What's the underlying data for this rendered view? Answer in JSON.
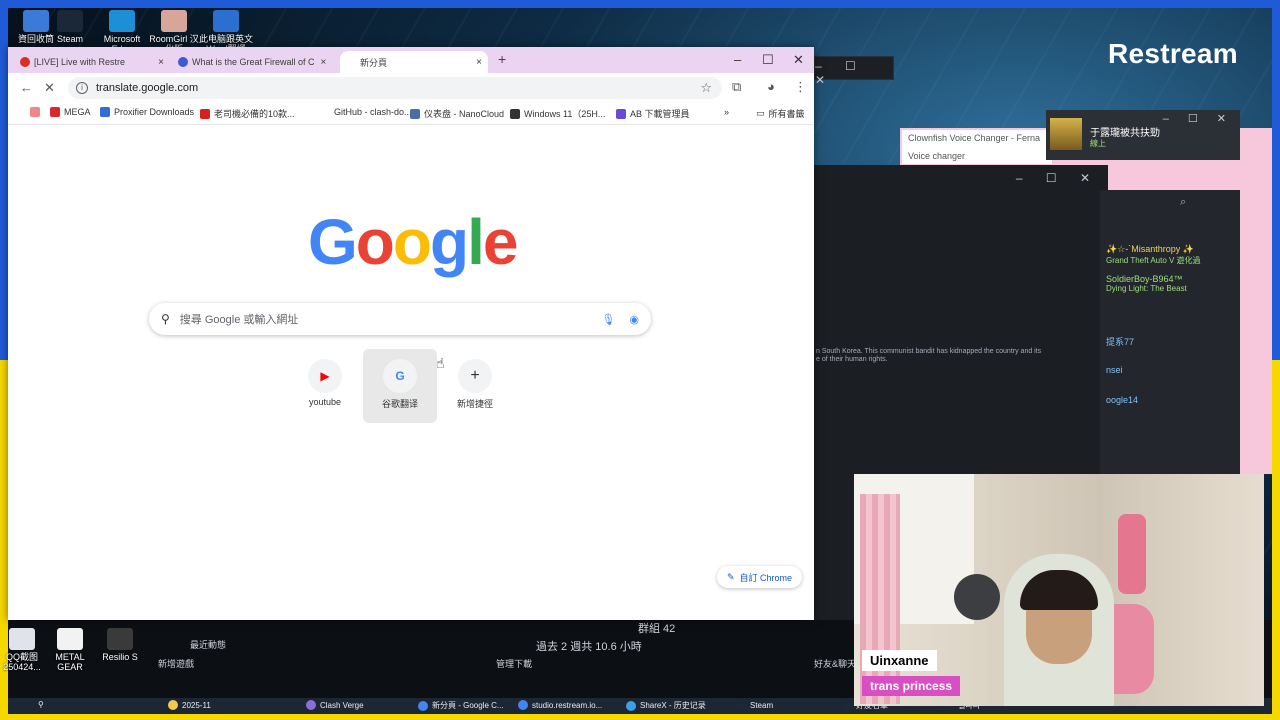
{
  "stream": {
    "logo": "Restream"
  },
  "desktop_icons": [
    {
      "label": "資回收筒",
      "color": "#3c7ad8"
    },
    {
      "label": "Steam",
      "color": "#1b2838"
    },
    {
      "label": "Microsoft Edge",
      "color": "#1c8fd6"
    },
    {
      "label": "RoomGirl 汉化版",
      "color": "#d8a59a"
    },
    {
      "label": "此电脑跟英文Word翻譯",
      "color": "#2b6fd1"
    }
  ],
  "desktop_icons_bottom": [
    {
      "label": "QQ截图 250424...",
      "color": "#e0e4ea"
    },
    {
      "label": "METAL GEAR SOLI...",
      "color": "#f2f2f2"
    },
    {
      "label": "Resilio S",
      "color": "#3a3a3a"
    }
  ],
  "chrome": {
    "tabs": [
      {
        "label": "[LIVE] Live with Restre",
        "fav": "#d93025",
        "close": "×"
      },
      {
        "label": "What is the Great Firewall of C",
        "fav": "#3b5bd6",
        "close": "×"
      },
      {
        "label": "新分頁",
        "fav": "#ffffff",
        "close": "×"
      }
    ],
    "new_tab": "+",
    "window_controls": {
      "min": "–",
      "max": "☐",
      "close": "✕"
    },
    "nav": {
      "back": "←",
      "reload": "✕"
    },
    "url": "translate.google.com",
    "star": "☆",
    "bookmarks": [
      {
        "label": "MEGA",
        "color": "#d9272e"
      },
      {
        "label": "Proxifier Downloads",
        "color": "#2e6ed6"
      },
      {
        "label": "老司機必備的10款...",
        "color": "#d61f1f"
      },
      {
        "label": "GitHub - clash-do...",
        "color": "#ffffff"
      },
      {
        "label": "仪表盘 - NanoCloud",
        "color": "#4a6fa8"
      },
      {
        "label": "Windows 11（25H...",
        "color": "#333333"
      },
      {
        "label": "AB 下載管理員",
        "color": "#6b4bd6"
      }
    ],
    "bookmarks_more": "»",
    "all_bookmarks": "所有書籤",
    "ntp": {
      "logo_letters": [
        "G",
        "o",
        "o",
        "g",
        "l",
        "e"
      ],
      "logo_colors": [
        "#4285f4",
        "#ea4335",
        "#fbbc05",
        "#4285f4",
        "#34a853",
        "#ea4335"
      ],
      "search_placeholder": "搜尋 Google 或輸入網址",
      "shortcuts": [
        {
          "label": "youtube",
          "glyph": "▶",
          "color": "#ff0000"
        },
        {
          "label": "谷歌翻译",
          "glyph": "G",
          "color": "#4285f4"
        },
        {
          "label": "新增捷徑",
          "glyph": "+",
          "color": "#202124"
        }
      ],
      "customize": "自訂 Chrome"
    }
  },
  "clownfish": {
    "title": "Clownfish Voice Changer - Ferna",
    "subtitle": "Voice changer"
  },
  "notification": {
    "name": "于露瓏被共扶勁",
    "sub": "線上"
  },
  "steam_text": [
    "n South Korea. This communist bandit has kidnapped the country and its",
    "e of their human rights."
  ],
  "friends": [
    {
      "name": "✨☆-`Misanthropy ✨",
      "game": "Grand Theft Auto V 遊化過"
    },
    {
      "name": "SoldierBoy-B964™",
      "game": "Dying Light: The Beast"
    },
    {
      "name": "提系77",
      "game": ""
    },
    {
      "name": "nsei",
      "game": ""
    },
    {
      "name": "oogle14",
      "game": ""
    }
  ],
  "lower": {
    "left_label": "新增遊戲",
    "mid_label": "管理下載",
    "right_label": "好友&聊天",
    "recent": "最近動態",
    "group": "群組 42",
    "stats": "過去 2 週共 10.6 小時"
  },
  "taskbar": [
    {
      "label": "2025-11",
      "color": "#f2c94c"
    },
    {
      "label": "Clash Verge",
      "color": "#8a6fd8"
    },
    {
      "label": "新分頁 - Google C...",
      "color": "#4285f4"
    },
    {
      "label": "studio.restream.io...",
      "color": "#4285f4"
    },
    {
      "label": "ShareX - 历史记录",
      "color": "#3aa0e8"
    },
    {
      "label": "Steam",
      "color": "#1b2838"
    },
    {
      "label": "好友名單",
      "color": "#1b2838"
    },
    {
      "label": "엘라라",
      "color": "#1b2838"
    }
  ],
  "webcam": {
    "name": "Uinxanne",
    "subtitle": "trans princess"
  }
}
